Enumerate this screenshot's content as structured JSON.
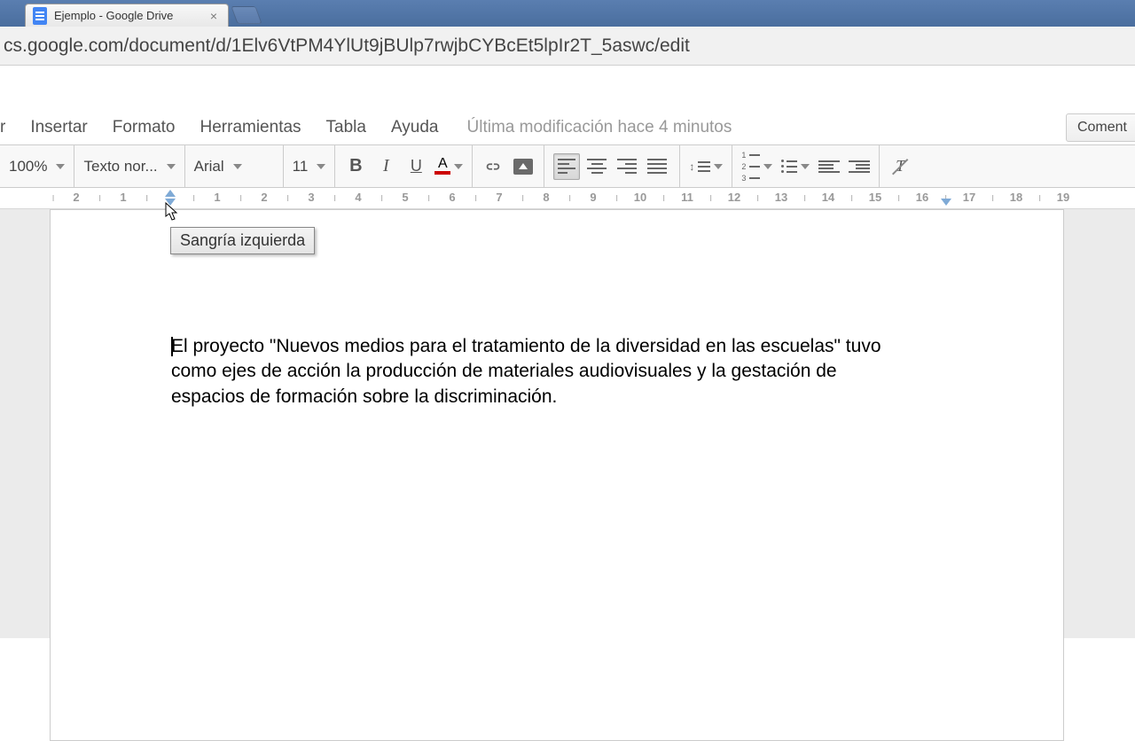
{
  "browser": {
    "tab_title": "Ejemplo - Google Drive",
    "url": "cs.google.com/document/d/1Elv6VtPM4YlUt9jBUlp7rwjbCYBcEt5lpIr2T_5aswc/edit"
  },
  "menu": {
    "items": [
      "r",
      "Insertar",
      "Formato",
      "Herramientas",
      "Tabla",
      "Ayuda"
    ],
    "status": "Última modificación hace 4 minutos",
    "comment_btn": "Coment"
  },
  "toolbar": {
    "zoom": "100%",
    "style": "Texto nor...",
    "font": "Arial",
    "size": "11",
    "bold": "B",
    "italic": "I",
    "underline": "U",
    "text_color_letter": "A"
  },
  "ruler": {
    "left_neg": [
      "2",
      "1"
    ],
    "numbers": [
      "1",
      "2",
      "3",
      "4",
      "5",
      "6",
      "7",
      "8",
      "9",
      "10",
      "11",
      "12",
      "13",
      "14",
      "15",
      "16",
      "17",
      "18",
      "19"
    ]
  },
  "tooltip": {
    "left_indent": "Sangría izquierda"
  },
  "document": {
    "paragraph": "El proyecto \"Nuevos medios para el tratamiento de la diversidad en las escuelas\" tuvo como ejes de acción la producción de materiales audiovisuales y la gestación de espacios de formación sobre la discriminación."
  }
}
